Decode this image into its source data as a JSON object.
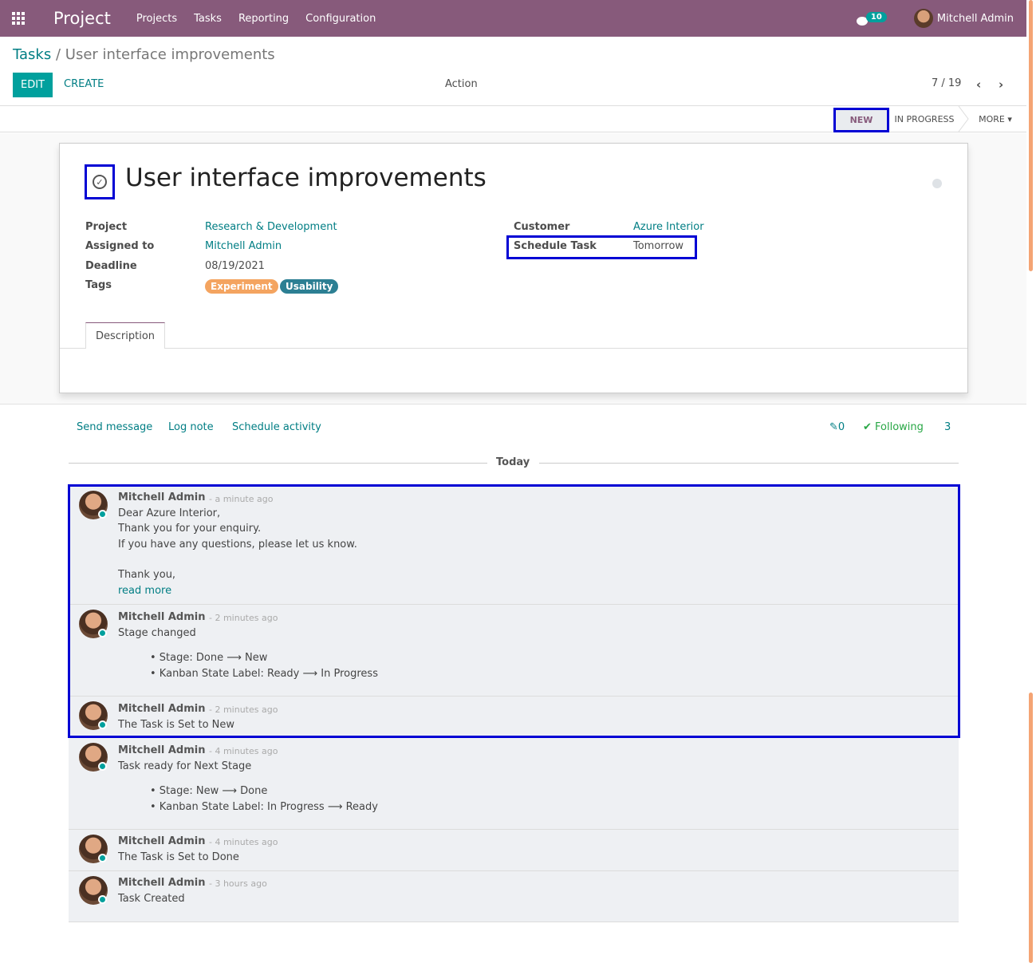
{
  "navbar": {
    "brand": "Project",
    "menu": [
      "Projects",
      "Tasks",
      "Reporting",
      "Configuration"
    ],
    "chat_count": "10",
    "user_name": "Mitchell Admin"
  },
  "breadcrumb": {
    "parent": "Tasks",
    "separator": "/",
    "current": "User interface improvements"
  },
  "control": {
    "edit_label": "EDIT",
    "create_label": "CREATE",
    "action_label": "Action",
    "pager": "7 / 19",
    "prev_icon": "‹",
    "next_icon": "›"
  },
  "stages": {
    "active": "NEW",
    "in_progress": "IN PROGRESS",
    "more": "MORE ▾"
  },
  "task": {
    "title": "User interface improvements",
    "check_icon": "✓",
    "fields": {
      "project_label": "Project",
      "project_value": "Research & Development",
      "assigned_label": "Assigned to",
      "assigned_value": "Mitchell Admin",
      "deadline_label": "Deadline",
      "deadline_value": "08/19/2021",
      "tags_label": "Tags",
      "tags": [
        "Experiment",
        "Usability"
      ],
      "customer_label": "Customer",
      "customer_value": "Azure Interior",
      "schedule_label": "Schedule Task",
      "schedule_value": "Tomorrow"
    },
    "tab_description": "Description"
  },
  "chatter": {
    "send_message": "Send message",
    "log_note": "Log note",
    "schedule_activity": "Schedule activity",
    "attachments": "✎0",
    "following": "✔ Following",
    "followers_count": "3",
    "today": "Today",
    "messages": [
      {
        "author": "Mitchell Admin",
        "date": "- a minute ago",
        "lines": [
          "Dear Azure Interior,",
          "Thank you for your enquiry.",
          "If you have any questions, please let us know.",
          "",
          "Thank you,"
        ],
        "read_more": "read more"
      },
      {
        "author": "Mitchell Admin",
        "date": "- 2 minutes ago",
        "lines": [
          "Stage changed"
        ],
        "tracking": [
          "• Stage: Done ⟶ New",
          "• Kanban State Label: Ready ⟶ In Progress"
        ]
      },
      {
        "author": "Mitchell Admin",
        "date": "- 2 minutes ago",
        "lines": [
          "The Task is Set to New"
        ]
      },
      {
        "author": "Mitchell Admin",
        "date": "- 4 minutes ago",
        "lines": [
          "Task ready for Next Stage"
        ],
        "tracking": [
          "• Stage: New ⟶ Done",
          "• Kanban State Label: In Progress ⟶ Ready"
        ]
      },
      {
        "author": "Mitchell Admin",
        "date": "- 4 minutes ago",
        "lines": [
          "The Task is Set to Done"
        ]
      },
      {
        "author": "Mitchell Admin",
        "date": "- 3 hours ago",
        "lines": [
          "Task Created"
        ]
      }
    ]
  },
  "colors": {
    "navbar": "#875a7b",
    "accent": "#00a09d",
    "link": "#017e84",
    "highlight": "#0000d4",
    "tag_experiment": "#f4a460",
    "tag_usability": "#2c7f93"
  }
}
